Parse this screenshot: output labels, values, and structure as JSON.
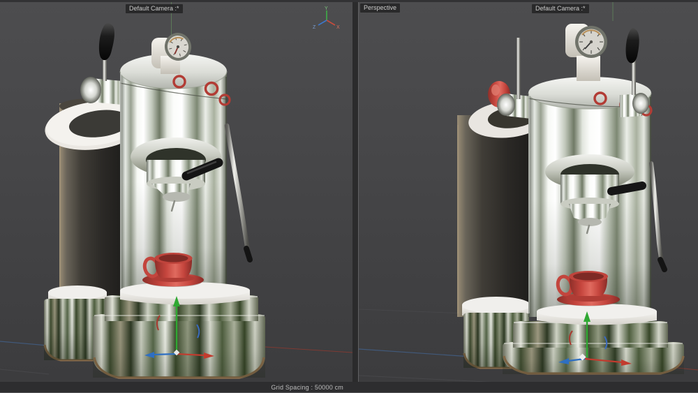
{
  "viewports": {
    "left": {
      "camera_label": "Default Camera :*"
    },
    "right": {
      "view_label": "Perspective",
      "camera_label": "Default Camera :*"
    }
  },
  "status_bar": {
    "grid_spacing_label": "Grid Spacing : 50000 cm"
  },
  "world_axis": {
    "x": "X",
    "y": "Y",
    "z": "Z"
  },
  "scene_objects": {
    "machine": "espresso-machine",
    "parts": [
      "pressure-gauge",
      "steam-lever",
      "boiler",
      "group-head",
      "portafilter-handle",
      "steam-wand",
      "espresso-cup",
      "saucer",
      "drip-tray",
      "chrome-base",
      "rear-tank",
      "move-gizmo"
    ]
  },
  "colors": {
    "viewport_bg_top": "#4d4d4f",
    "viewport_bg_bottom": "#3c3c3e",
    "status_bar_bg": "#2d2d2f",
    "label_text": "#cccccc",
    "cup_red": "#c5453d",
    "ring_red": "#b23c35",
    "tray_white": "#efeeea",
    "base_tan_rim": "#8a6d4c",
    "axis_x_red": "#c84b3c",
    "axis_y_green": "#3fae46",
    "axis_z_blue": "#3e77c9",
    "grid_line_gray": "#47474a"
  }
}
